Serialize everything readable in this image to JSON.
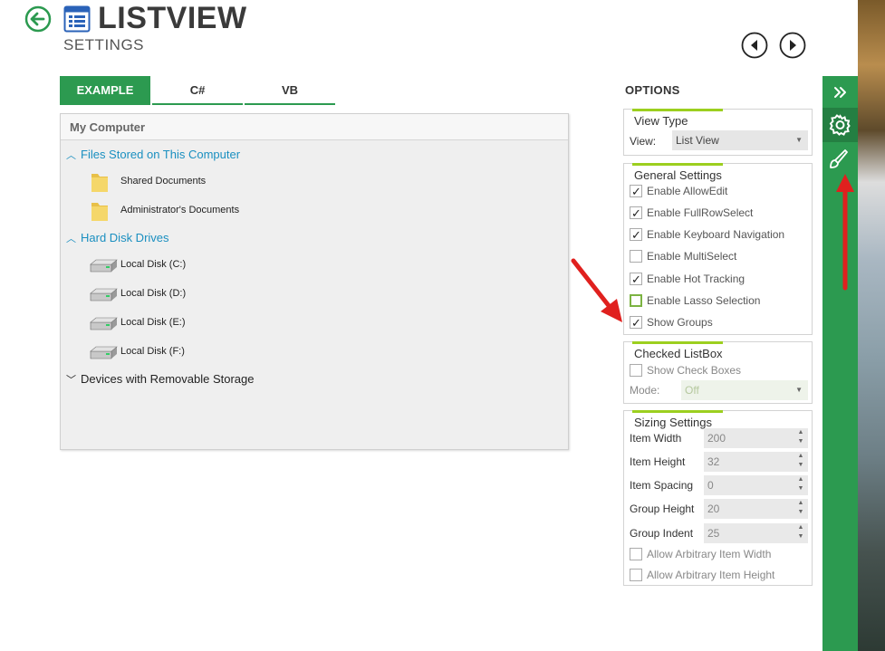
{
  "header": {
    "title": "LISTVIEW",
    "subtitle": "SETTINGS"
  },
  "colors": {
    "accent": "#2c9a50",
    "link": "#1a8fc0",
    "highlight": "#9ccf1f",
    "annotation_arrow": "#e0201e"
  },
  "tabs": [
    {
      "label": "EXAMPLE",
      "active": true
    },
    {
      "label": "C#",
      "active": false
    },
    {
      "label": "VB",
      "active": false
    }
  ],
  "listview": {
    "header": "My Computer",
    "groups": [
      {
        "label": "Files Stored on This Computer",
        "expanded": true,
        "items": [
          "Shared Documents",
          "Administrator's Documents"
        ]
      },
      {
        "label": "Hard Disk Drives",
        "expanded": true,
        "items": [
          "Local Disk (C:)",
          "Local Disk (D:)",
          "Local Disk (E:)",
          "Local Disk (F:)"
        ]
      },
      {
        "label": "Devices with Removable Storage",
        "expanded": false,
        "items": []
      }
    ]
  },
  "options": {
    "title": "OPTIONS",
    "view_type": {
      "title": "View Type",
      "view_label": "View:",
      "view_value": "List View"
    },
    "general": {
      "title": "General Settings",
      "items": [
        {
          "label": "Enable AllowEdit",
          "checked": true
        },
        {
          "label": "Enable FullRowSelect",
          "checked": true
        },
        {
          "label": "Enable Keyboard Navigation",
          "checked": true
        },
        {
          "label": "Enable MultiSelect",
          "checked": false
        },
        {
          "label": "Enable Hot Tracking",
          "checked": true
        },
        {
          "label": "Enable Lasso Selection",
          "checked": false
        },
        {
          "label": "Show Groups",
          "checked": true
        }
      ]
    },
    "checked_listbox": {
      "title": "Checked ListBox",
      "show_check_boxes": "Show Check Boxes",
      "mode_label": "Mode:",
      "mode_value": "Off"
    },
    "sizing": {
      "title": "Sizing Settings",
      "fields": [
        {
          "label": "Item Width",
          "value": "200"
        },
        {
          "label": "Item Height",
          "value": "32"
        },
        {
          "label": "Item Spacing",
          "value": "0"
        },
        {
          "label": "Group Height",
          "value": "20"
        },
        {
          "label": "Group Indent",
          "value": "25"
        }
      ],
      "checks": [
        {
          "label": "Allow Arbitrary Item Width",
          "checked": false
        },
        {
          "label": "Allow Arbitrary Item Height",
          "checked": false
        }
      ]
    }
  },
  "sidebar": {
    "buttons": [
      "chevron-double-right-icon",
      "gear-icon",
      "brush-icon"
    ]
  }
}
